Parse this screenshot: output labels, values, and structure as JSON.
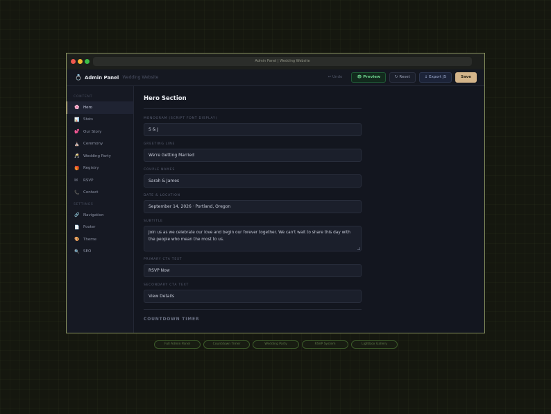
{
  "window": {
    "title": "Admin Panel | Wedding Website"
  },
  "header": {
    "logo": "💍",
    "brand": "Admin Panel",
    "subtitle": "Wedding Website",
    "actions": {
      "undo": "↩ Undo",
      "preview": "👁 Preview",
      "reset": "↻ Reset",
      "export": "↓ Export JS",
      "save": "Save"
    }
  },
  "sidebar": {
    "content_label": "CONTENT",
    "settings_label": "SETTINGS",
    "content_items": [
      {
        "icon": "🌸",
        "label": "Hero",
        "active": true
      },
      {
        "icon": "📊",
        "label": "Stats"
      },
      {
        "icon": "💕",
        "label": "Our Story"
      },
      {
        "icon": "⛪",
        "label": "Ceremony"
      },
      {
        "icon": "🥂",
        "label": "Wedding Party"
      },
      {
        "icon": "🎁",
        "label": "Registry"
      },
      {
        "icon": "✉",
        "label": "RSVP"
      },
      {
        "icon": "📞",
        "label": "Contact"
      }
    ],
    "settings_items": [
      {
        "icon": "🔗",
        "label": "Navigation"
      },
      {
        "icon": "📄",
        "label": "Footer"
      },
      {
        "icon": "🎨",
        "label": "Theme"
      },
      {
        "icon": "🔍",
        "label": "SEO"
      }
    ]
  },
  "main": {
    "title": "Hero Section",
    "fields": {
      "monogram": {
        "label": "MONOGRAM (SCRIPT FONT DISPLAY)",
        "value": "S & J"
      },
      "greeting": {
        "label": "GREETING LINE",
        "value": "We're Getting Married"
      },
      "names": {
        "label": "COUPLE NAMES",
        "value": "Sarah & James"
      },
      "date": {
        "label": "DATE & LOCATION",
        "value": "September 14, 2026 · Portland, Oregon"
      },
      "subtitle": {
        "label": "SUBTITLE",
        "value": "Join us as we celebrate our love and begin our forever together. We can't wait to share this day with the people who mean the most to us."
      },
      "primary_cta": {
        "label": "PRIMARY CTA TEXT",
        "value": "RSVP Now"
      },
      "secondary_cta": {
        "label": "SECONDARY CTA TEXT",
        "value": "View Details"
      }
    },
    "next_section": "COUNTDOWN TIMER"
  },
  "pills": [
    "Full Admin Panel",
    "Countdown Timer",
    "Wedding Party",
    "RSVP System",
    "Lightbox Gallery"
  ]
}
